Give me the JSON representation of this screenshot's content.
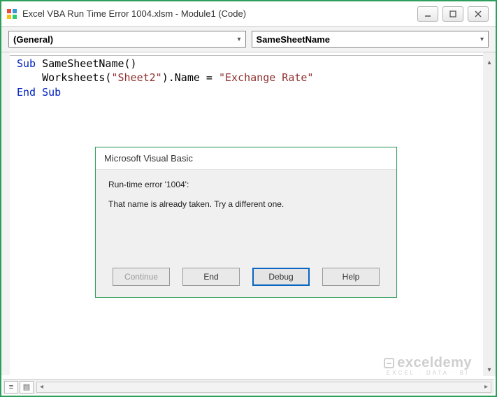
{
  "window": {
    "title": "Excel VBA Run Time Error 1004.xlsm - Module1 (Code)"
  },
  "dropdowns": {
    "left": "(General)",
    "right": "SameSheetName"
  },
  "code": {
    "line1_kw": "Sub",
    "line1_name": " SameSheetName()",
    "line2_a": "    Worksheets(",
    "line2_str1": "\"Sheet2\"",
    "line2_b": ").Name = ",
    "line2_str2": "\"Exchange Rate\"",
    "line3_kw": "End Sub"
  },
  "dialog": {
    "title": "Microsoft Visual Basic",
    "error_header": "Run-time error '1004':",
    "error_message": "That name is already taken. Try a different one.",
    "btn_continue": "Continue",
    "btn_end": "End",
    "btn_debug": "Debug",
    "btn_help": "Help"
  },
  "watermark": {
    "brand": "exceldemy",
    "tag": "EXCEL · DATA · BI"
  }
}
